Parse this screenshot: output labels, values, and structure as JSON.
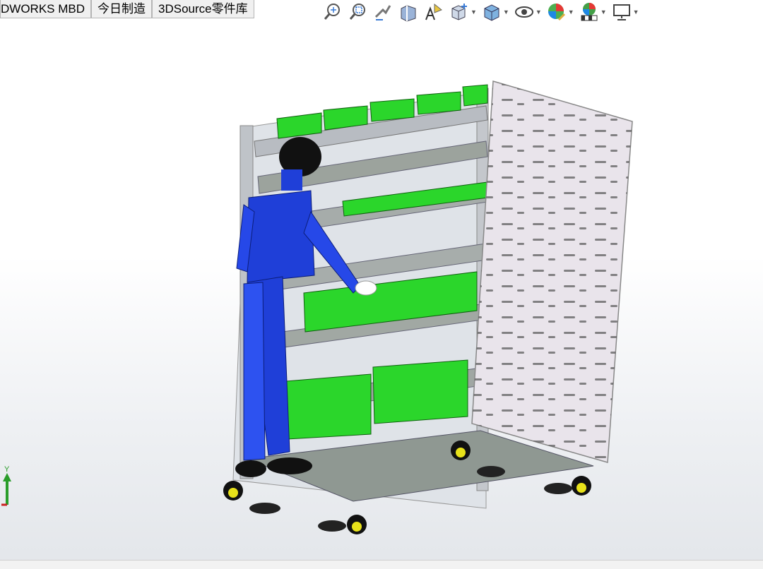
{
  "tabs": [
    {
      "label": "DWORKS MBD"
    },
    {
      "label": "今日制造"
    },
    {
      "label": "3DSource零件库"
    }
  ],
  "toolbar": {
    "icons": [
      "zoom-to-fit-icon",
      "zoom-to-area-icon",
      "previous-view-icon",
      "section-view-icon",
      "dynamic-annotation-icon",
      "view-orientation-icon",
      "display-style-icon",
      "hide-show-items-icon",
      "edit-appearance-icon",
      "apply-scene-icon",
      "view-settings-icon"
    ]
  },
  "triad": {
    "y_label": "Y"
  },
  "colors": {
    "bins": "#2bd62b",
    "suit": "#1f3fd8",
    "frame": "#c9ccd2",
    "panel": "#e8e3ea",
    "wheel": "#e8e21a"
  }
}
